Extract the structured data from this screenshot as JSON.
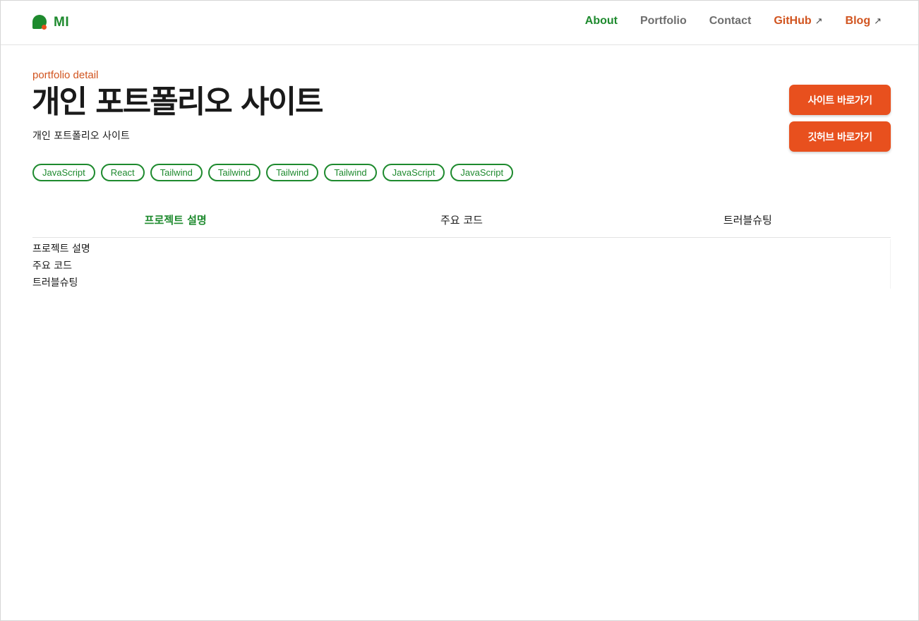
{
  "header": {
    "logo_text": "MI",
    "nav": [
      {
        "label": "About"
      },
      {
        "label": "Portfolio"
      },
      {
        "label": "Contact"
      },
      {
        "label": "GitHub",
        "arrow": "↗"
      },
      {
        "label": "Blog",
        "arrow": "↗"
      }
    ]
  },
  "hero": {
    "eyebrow": "portfolio detail",
    "title": "개인 포트폴리오 사이트",
    "subtitle": "개인 포트폴리오 사이트",
    "buttons": {
      "site": "사이트 바로가기",
      "github": "깃허브 바로가기"
    }
  },
  "tags": [
    "JavaScript",
    "React",
    "Tailwind",
    "Tailwind",
    "Tailwind",
    "Tailwind",
    "JavaScript",
    "JavaScript"
  ],
  "tabs": [
    {
      "label": "프로젝트 설명"
    },
    {
      "label": "주요 코드"
    },
    {
      "label": "트러블슈팅"
    }
  ],
  "content": {
    "lines": [
      "프로젝트 설명",
      "주요 코드",
      "트러블슈팅"
    ]
  },
  "colors": {
    "brand_green": "#1e8a2e",
    "accent_orange": "#e8501e",
    "external_link": "#d1541f",
    "nav_muted": "#6e6e6e"
  },
  "icons": {
    "logo": "leaf-logo-icon",
    "external": "arrow-up-right-icon"
  }
}
